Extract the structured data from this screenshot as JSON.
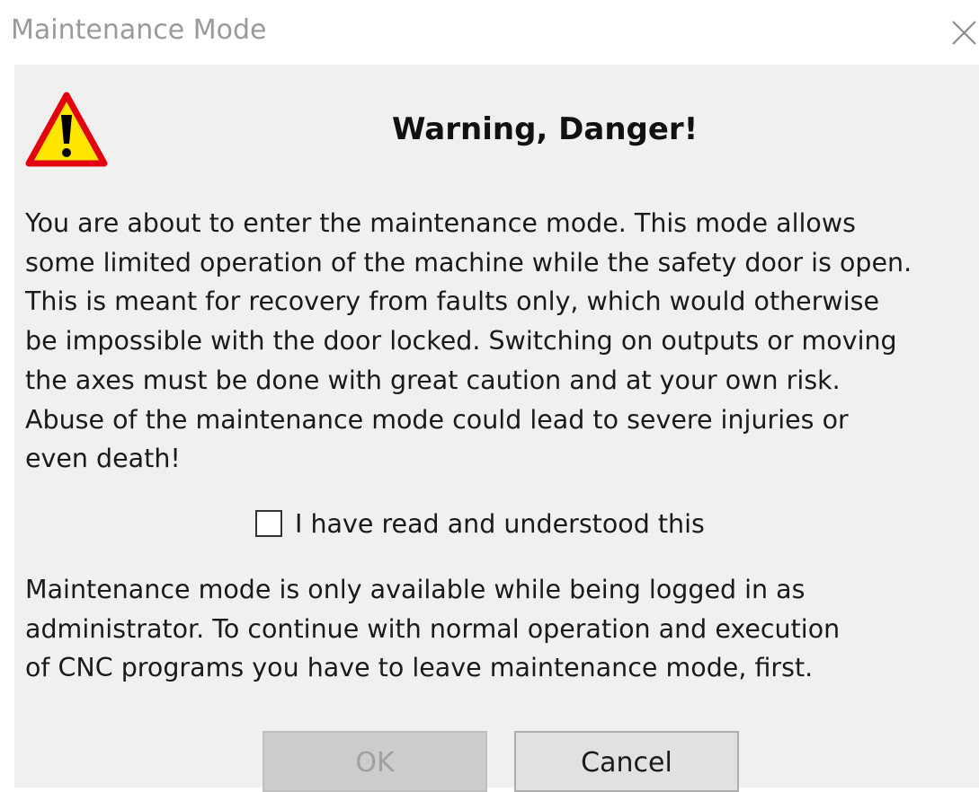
{
  "window": {
    "title": "Maintenance Mode",
    "close_icon": "close-icon"
  },
  "dialog": {
    "icon": "warning-icon",
    "heading": "Warning, Danger!",
    "message_lines": [
      "You are about to enter the maintenance mode. This mode allows",
      "some limited operation of the machine while the safety door is open.",
      "This is meant for recovery from faults only, which would otherwise",
      "be impossible with the door locked. Switching on outputs or moving",
      "the axes must be done with great caution and at your own risk.",
      "Abuse of the maintenance mode could lead to severe injuries or",
      "even death!"
    ],
    "checkbox": {
      "label": "I have read and understood this",
      "checked": false
    },
    "info_lines": [
      "Maintenance mode is only available while being logged in as",
      "administrator. To continue with normal operation and execution",
      "of CNC programs you have to leave maintenance mode, first."
    ],
    "buttons": {
      "ok_label": "OK",
      "ok_enabled": false,
      "cancel_label": "Cancel"
    }
  },
  "colors": {
    "warning_fill": "#ffe500",
    "warning_border": "#e3000f",
    "dialog_bg": "#f0f0f0"
  }
}
